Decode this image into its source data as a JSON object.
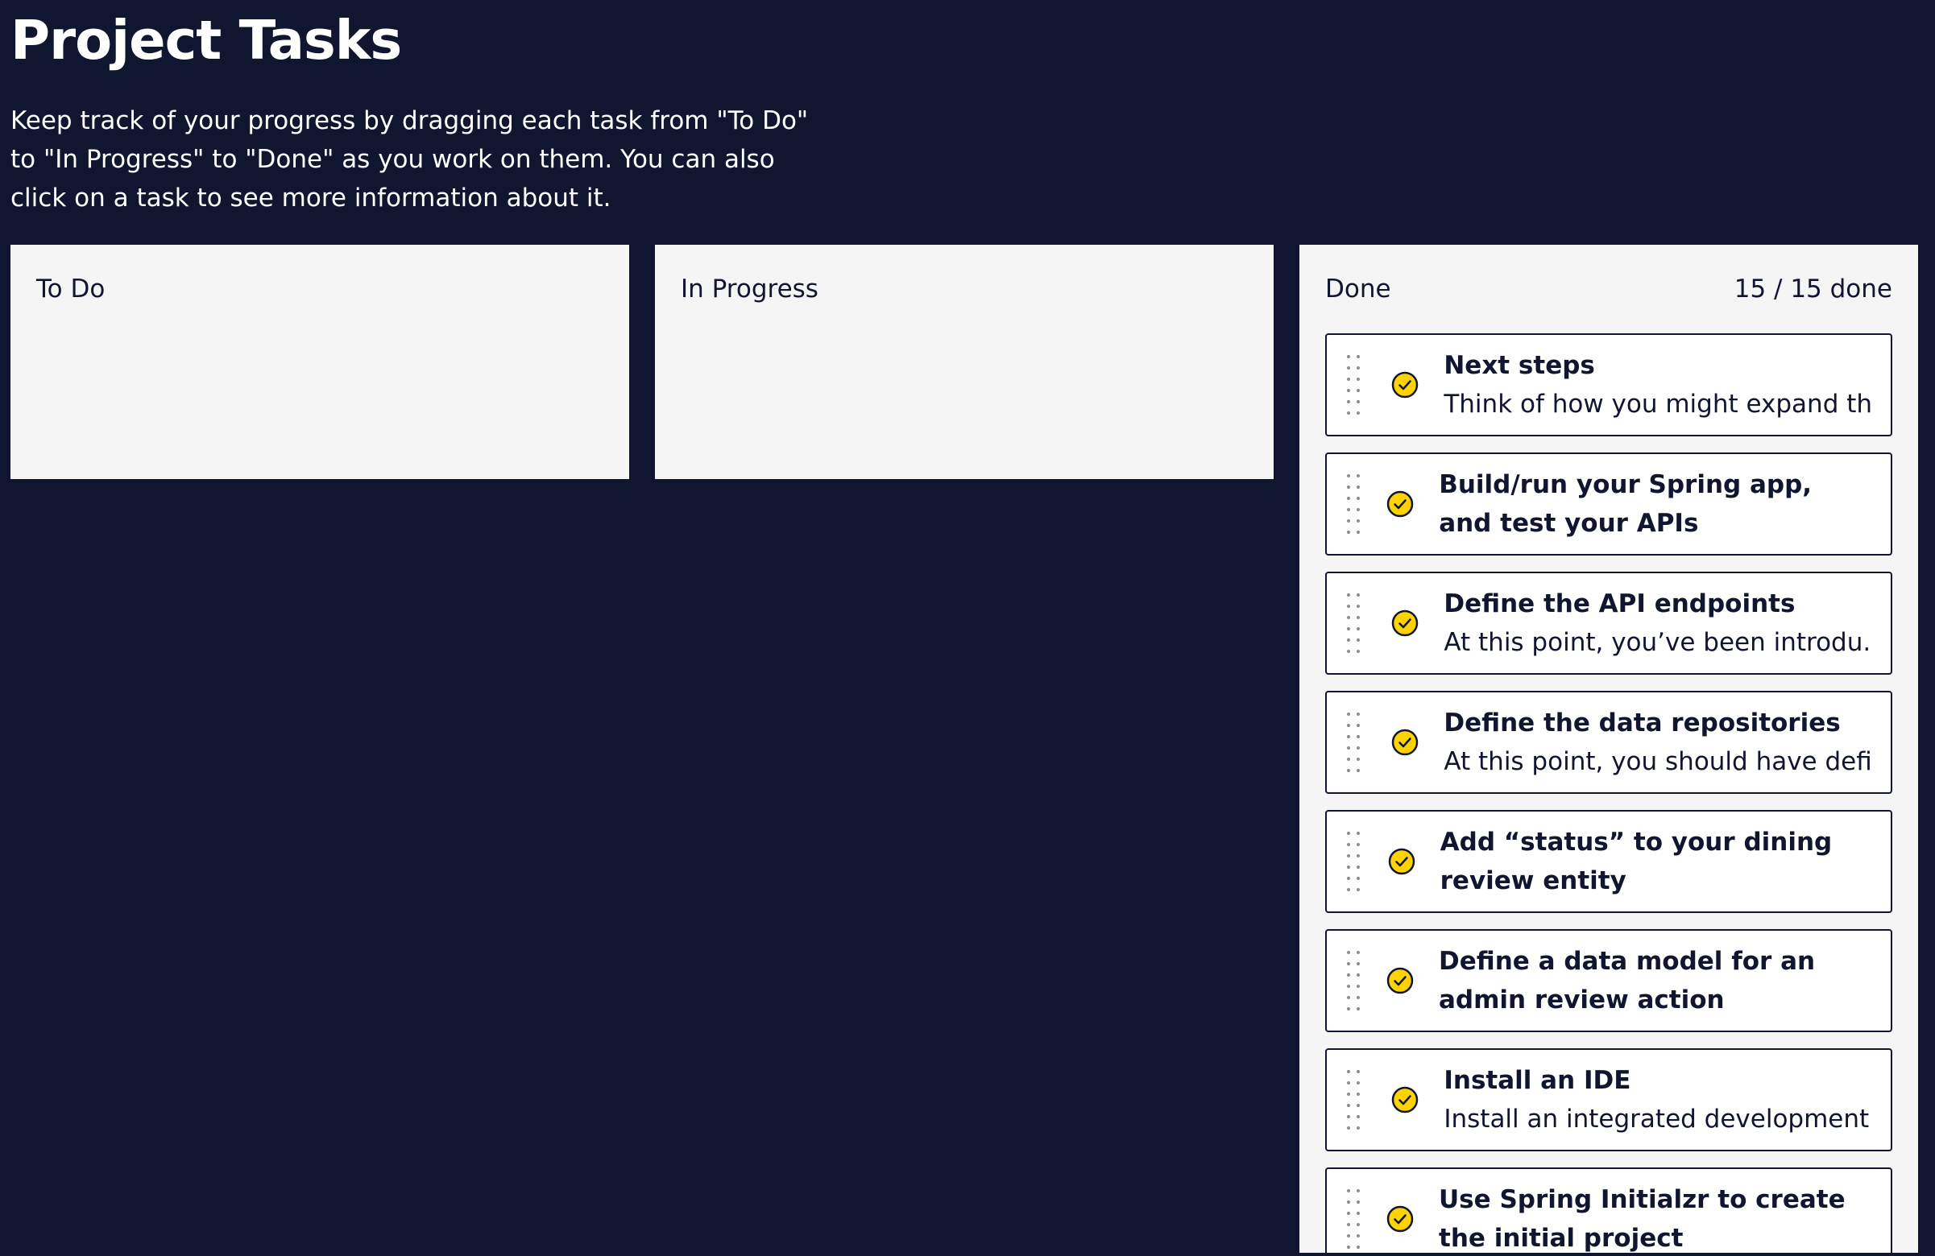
{
  "page": {
    "title": "Project Tasks",
    "intro_lines": [
      "Keep track of your progress by dragging each task from \"To Do\"",
      "to \"In Progress\" to \"Done\" as you work on them. You can also",
      "click on a task to see more information about it."
    ]
  },
  "columns": {
    "todo": {
      "title": "To Do"
    },
    "in_progress": {
      "title": "In Progress"
    },
    "done": {
      "title": "Done",
      "count_label": "15 / 15 done",
      "tasks": [
        {
          "title": "Next steps",
          "description": "Think of how you might expand th..."
        },
        {
          "title": "Build/run your Spring app, and test your APIs",
          "description": ""
        },
        {
          "title": "Define the API endpoints",
          "description": "At this point, you’ve been introdu..."
        },
        {
          "title": "Define the data repositories",
          "description": "At this point, you should have defi..."
        },
        {
          "title": "Add “status” to your dining review entity",
          "description": ""
        },
        {
          "title": "Define a data model for an admin review action",
          "description": ""
        },
        {
          "title": "Install an IDE",
          "description": "Install an integrated development..."
        },
        {
          "title": "Use Spring Initialzr to create the initial project",
          "description": ""
        }
      ]
    }
  },
  "colors": {
    "background": "#10162f",
    "column_bg": "#f5f5f5",
    "card_border": "#10162f",
    "check_fill": "#ffd300"
  },
  "icons": {
    "task_status": "check-circle-icon",
    "drag": "drag-handle-icon"
  }
}
